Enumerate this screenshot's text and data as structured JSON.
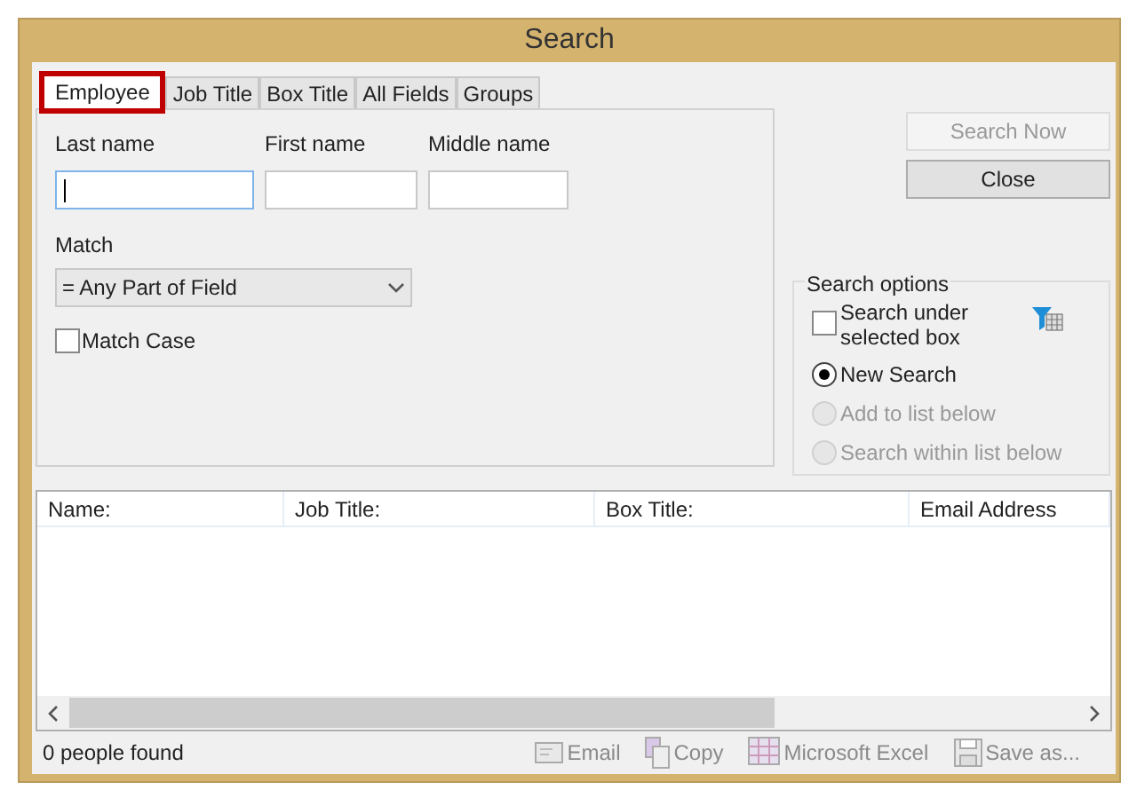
{
  "window": {
    "title": "Search"
  },
  "tabs": [
    {
      "label": "Employee",
      "selected": true
    },
    {
      "label": "Job Title",
      "selected": false
    },
    {
      "label": "Box Title",
      "selected": false
    },
    {
      "label": "All Fields",
      "selected": false
    },
    {
      "label": "Groups",
      "selected": false
    }
  ],
  "name_fields": [
    {
      "label": "Last name",
      "focused": true
    },
    {
      "label": "First name",
      "focused": false
    },
    {
      "label": "Middle name",
      "focused": false
    }
  ],
  "match": {
    "label": "Match",
    "value": "= Any Part of Field"
  },
  "match_case": {
    "label": "Match Case",
    "checked": false
  },
  "buttons": [
    {
      "label": "Search Now",
      "disabled": true
    },
    {
      "label": "Close",
      "disabled": false
    }
  ],
  "search_options": {
    "title": "Search options",
    "under_box": {
      "label": "Search under selected box",
      "checked": false
    },
    "modes": [
      {
        "label": "New Search",
        "selected": true,
        "disabled": false
      },
      {
        "label": "Add to list below",
        "selected": false,
        "disabled": true
      },
      {
        "label": "Search within list below",
        "selected": false,
        "disabled": true
      }
    ]
  },
  "table": {
    "columns": [
      "Name:",
      "Job Title:",
      "Box Title:",
      "Email Address"
    ]
  },
  "status_bar": {
    "text": "0 people found",
    "actions": [
      {
        "label": "Email",
        "kind": "email",
        "disabled": true
      },
      {
        "label": "Copy",
        "kind": "copy",
        "disabled": true
      },
      {
        "label": "Microsoft Excel",
        "kind": "excel",
        "disabled": true
      },
      {
        "label": "Save as...",
        "kind": "save",
        "disabled": true
      }
    ]
  }
}
